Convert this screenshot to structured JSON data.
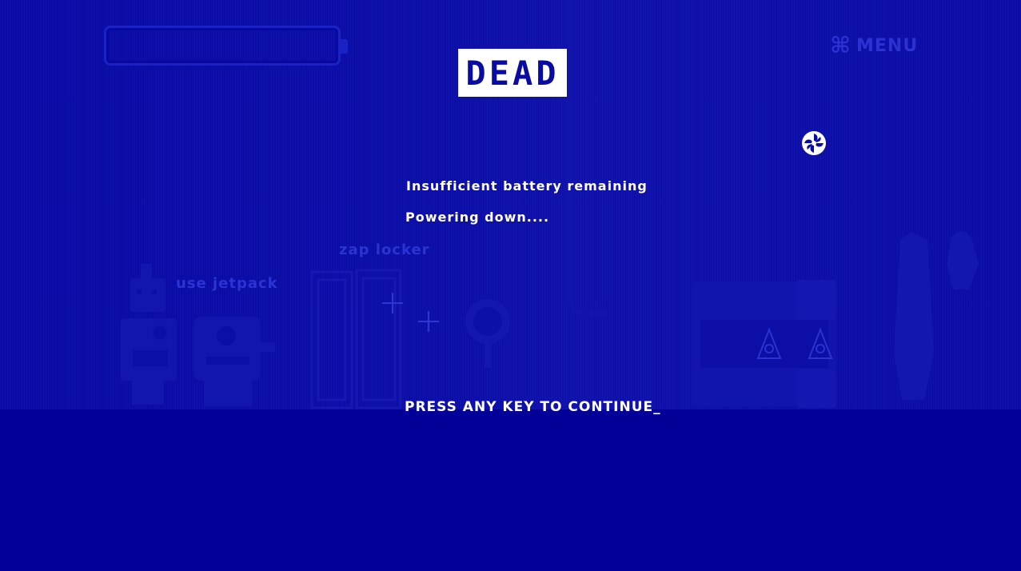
{
  "hud": {
    "battery_level": 0,
    "status_badge": "DEAD",
    "menu_icon": "command-icon",
    "menu_label": "MENU",
    "fan_icon": "fan-icon"
  },
  "messages": {
    "line1": "Insufficient battery remaining",
    "line2": "Powering down...."
  },
  "scene_hints": {
    "jetpack": "use jetpack",
    "locker": "zap locker"
  },
  "prompt": {
    "continue": "PRESS ANY KEY TO CONTINUE_"
  },
  "colors": {
    "background": "#0a0ba6",
    "floor": "#020096",
    "badge_bg": "#ffffff",
    "badge_text": "#0a0ba0",
    "faded_ui": "#2a32d2",
    "text": "#ffffff"
  }
}
